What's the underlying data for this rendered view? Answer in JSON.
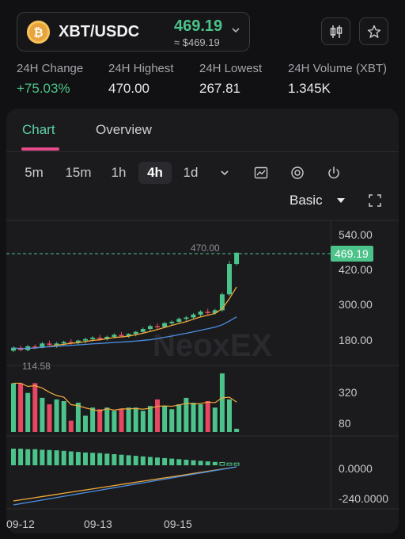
{
  "header": {
    "coin_symbol": "₿",
    "pair": "XBT/USDC",
    "price": "469.19",
    "price_usd": "≈ $469.19",
    "icons": [
      "candlestick-icon",
      "star-icon"
    ]
  },
  "stats": [
    {
      "label": "24H Change",
      "value": "+75.03%",
      "positive": true
    },
    {
      "label": "24H Highest",
      "value": "470.00"
    },
    {
      "label": "24H Lowest",
      "value": "267.81"
    },
    {
      "label": "24H Volume (XBT)",
      "value": "1.345K"
    }
  ],
  "tabs": [
    "Chart",
    "Overview"
  ],
  "active_tab": "Chart",
  "timeframes": [
    "5m",
    "15m",
    "1h",
    "4h",
    "1d"
  ],
  "active_timeframe": "4h",
  "toolbar_icons": [
    "chevron-down-icon",
    "indicator-icon",
    "target-icon",
    "power-icon"
  ],
  "chart_mode": "Basic",
  "watermark": "NeoxEX",
  "colors": {
    "up": "#4cc38a",
    "down": "#e5485f",
    "accent": "#5fd3a3",
    "ma_short": "#f2a93b",
    "ma_long": "#4a8fe0"
  },
  "chart_data": {
    "type": "candlestick",
    "price_axis": {
      "ticks": [
        "540.00",
        "420.00",
        "300.00",
        "180.00"
      ],
      "ylim": [
        90,
        570
      ]
    },
    "current_price_label": "469.19",
    "high_marker": "470.00",
    "low_marker": "114.58",
    "x_ticks": [
      "09-12",
      "09-13",
      "09-15"
    ],
    "volume_axis": {
      "ticks": [
        "320",
        "80"
      ]
    },
    "macd_axis": {
      "ticks": [
        "0.0000",
        "-240.0000"
      ]
    },
    "candles": [
      [
        130,
        145,
        125,
        140
      ],
      [
        140,
        148,
        128,
        132
      ],
      [
        132,
        150,
        128,
        145
      ],
      [
        145,
        152,
        135,
        140
      ],
      [
        140,
        160,
        138,
        155
      ],
      [
        155,
        165,
        145,
        150
      ],
      [
        150,
        160,
        140,
        155
      ],
      [
        155,
        165,
        148,
        160
      ],
      [
        160,
        170,
        150,
        158
      ],
      [
        158,
        168,
        150,
        165
      ],
      [
        165,
        175,
        155,
        170
      ],
      [
        170,
        180,
        162,
        175
      ],
      [
        175,
        185,
        165,
        170
      ],
      [
        170,
        182,
        165,
        178
      ],
      [
        178,
        190,
        172,
        185
      ],
      [
        185,
        195,
        178,
        180
      ],
      [
        180,
        190,
        175,
        188
      ],
      [
        188,
        198,
        180,
        195
      ],
      [
        195,
        210,
        190,
        205
      ],
      [
        205,
        220,
        198,
        215
      ],
      [
        215,
        225,
        205,
        212
      ],
      [
        212,
        230,
        208,
        225
      ],
      [
        225,
        235,
        218,
        230
      ],
      [
        230,
        245,
        225,
        240
      ],
      [
        240,
        250,
        232,
        245
      ],
      [
        245,
        260,
        238,
        255
      ],
      [
        255,
        270,
        248,
        265
      ],
      [
        265,
        275,
        255,
        260
      ],
      [
        260,
        275,
        255,
        270
      ],
      [
        270,
        330,
        265,
        325
      ],
      [
        325,
        440,
        320,
        430
      ],
      [
        430,
        470,
        425,
        469
      ]
    ],
    "volumes": [
      300,
      300,
      240,
      300,
      210,
      170,
      200,
      190,
      70,
      180,
      100,
      150,
      140,
      150,
      130,
      140,
      150,
      150,
      130,
      160,
      200,
      160,
      140,
      170,
      210,
      180,
      170,
      190,
      150,
      360,
      200,
      20
    ],
    "macd": [
      60,
      60,
      58,
      58,
      56,
      55,
      54,
      52,
      50,
      48,
      46,
      45,
      44,
      42,
      40,
      38,
      36,
      34,
      32,
      30,
      28,
      26,
      24,
      22,
      20,
      18,
      16,
      14,
      12,
      10,
      8,
      8
    ]
  }
}
